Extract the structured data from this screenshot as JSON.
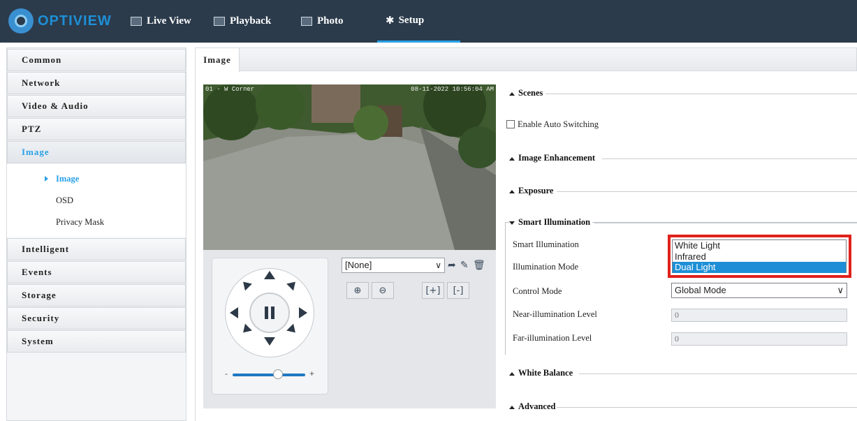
{
  "brand": {
    "logo_text": "OPTIVIEW"
  },
  "nav": [
    {
      "label": "Live View",
      "icon": "monitor-icon"
    },
    {
      "label": "Playback",
      "icon": "film-icon"
    },
    {
      "label": "Photo",
      "icon": "image-icon"
    },
    {
      "label": "Setup",
      "icon": "gear-icon",
      "active": true
    }
  ],
  "sidebar": {
    "items": [
      "Common",
      "Network",
      "Video & Audio",
      "PTZ",
      "Image",
      "Intelligent",
      "Events",
      "Storage",
      "Security",
      "System"
    ],
    "active": "Image",
    "submenu": [
      "Image",
      "OSD",
      "Privacy Mask"
    ],
    "active_sub": "Image"
  },
  "tab": {
    "label": "Image"
  },
  "video": {
    "osd_left": "01 - W Corner",
    "osd_right": "08-11-2022 10:56:04 AM"
  },
  "ptz": {
    "preset_value": "[None]",
    "slider_minus": "-",
    "slider_plus": "+",
    "zoom_in": "⊕",
    "zoom_out": "⊖",
    "focus_near": "[+]",
    "focus_far": "[-]"
  },
  "sections": {
    "scenes": "Scenes",
    "image_enhancement": "Image Enhancement",
    "exposure": "Exposure",
    "smart_illumination": "Smart Illumination",
    "white_balance": "White Balance",
    "advanced": "Advanced"
  },
  "scenes": {
    "auto_switch_label": "Enable Auto Switching"
  },
  "smart": {
    "smart_illumination_label": "Smart Illumination",
    "illumination_mode_label": "Illumination Mode",
    "control_mode_label": "Control Mode",
    "near_label": "Near-illumination Level",
    "far_label": "Far-illumination Level",
    "options": [
      "White Light",
      "Infrared",
      "Dual Light"
    ],
    "selected_option": "Dual Light",
    "control_mode_value": "Global Mode",
    "near_value": "0",
    "far_value": "0"
  },
  "colors": {
    "accent": "#2aa0e6",
    "header": "#2b3b4c",
    "highlight_border": "#e0211b"
  }
}
